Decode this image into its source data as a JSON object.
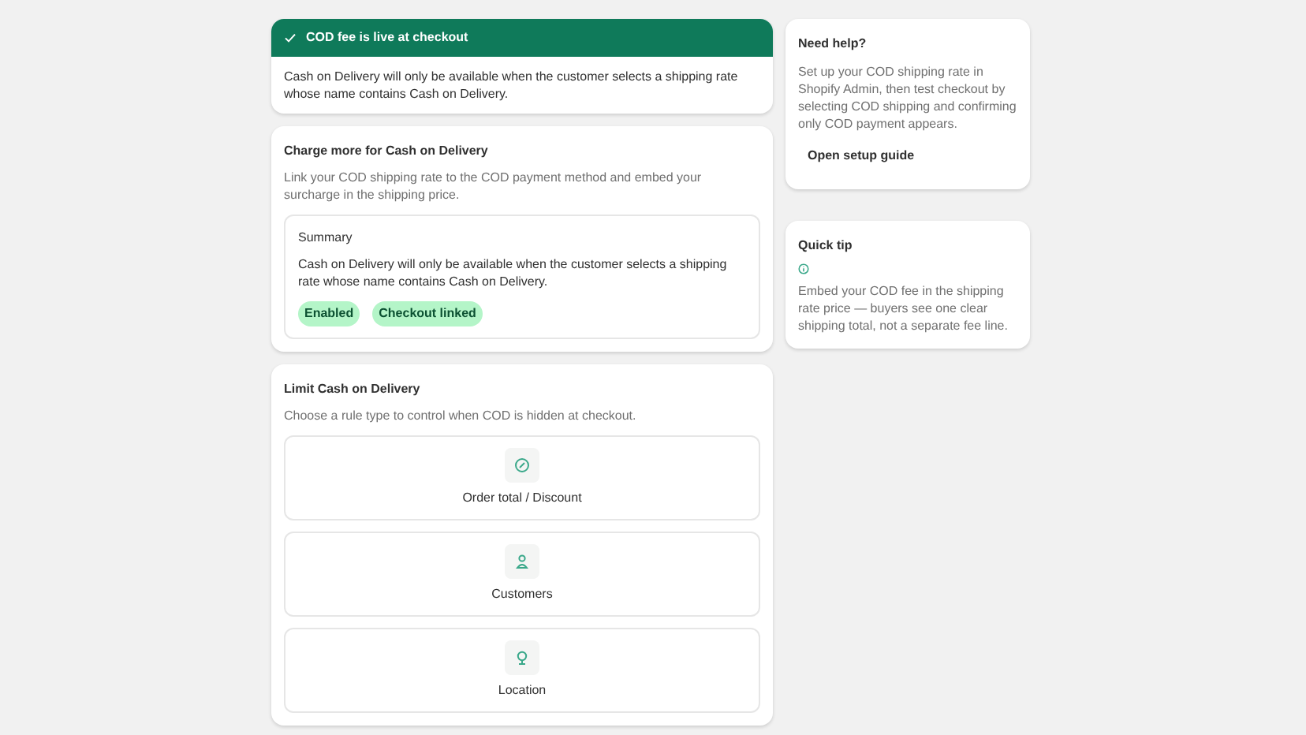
{
  "banner": {
    "title": "COD fee is live at checkout",
    "text": "Cash on Delivery will only be available when the customer selects a shipping rate whose name contains Cash on Delivery."
  },
  "charge": {
    "title": "Charge more for Cash on Delivery",
    "description": "Link your COD shipping rate to the COD payment method and embed your surcharge in the shipping price.",
    "summary": {
      "title": "Summary",
      "text": "Cash on Delivery will only be available when the customer selects a shipping rate whose name contains Cash on Delivery.",
      "badges": [
        "Enabled",
        "Checkout linked"
      ]
    }
  },
  "limit": {
    "title": "Limit Cash on Delivery",
    "description": "Choose a rule type to control when COD is hidden at checkout.",
    "rules": [
      {
        "kind": "discount",
        "label": "Order total / Discount"
      },
      {
        "kind": "customer",
        "label": "Customers"
      },
      {
        "kind": "location",
        "label": "Location"
      }
    ]
  },
  "help": {
    "title": "Need help?",
    "text": "Set up your COD shipping rate in Shopify Admin, then test checkout by selecting COD shipping and confirming only COD payment appears.",
    "link": "Open setup guide"
  },
  "tip": {
    "title": "Quick tip",
    "text": "Embed your COD fee in the shipping rate price — buyers see one clear shipping total, not a separate fee line."
  }
}
